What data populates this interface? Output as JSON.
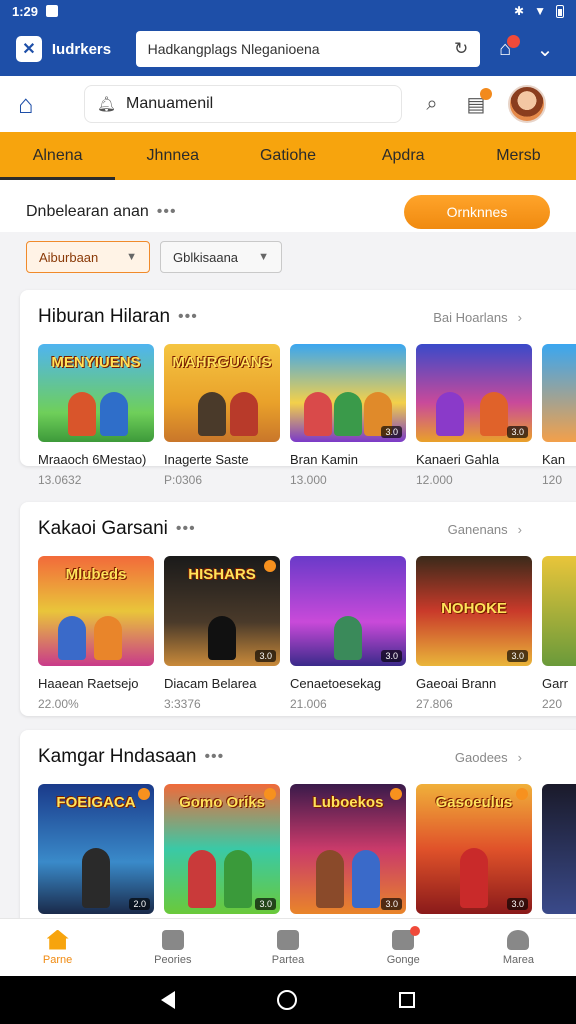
{
  "status_bar": {
    "time": "1:29"
  },
  "browser": {
    "app_name": "Iudrkers",
    "url": "Hadkangplags Nleganioena"
  },
  "header": {
    "search_text": "Manuamenil"
  },
  "category_tabs": [
    "Alnena",
    "Jhnnea",
    "Gatiohe",
    "Apdra",
    "Mersb"
  ],
  "sort": {
    "label": "Dnbelearan anan",
    "cta_label": "Ornknnes"
  },
  "filters": [
    {
      "label": "Aiburbaan"
    },
    {
      "label": "Gblkisaana"
    }
  ],
  "sections": [
    {
      "title": "Hiburan Hilaran",
      "more_label": "Bai Hoarlans",
      "cards": [
        {
          "art": "MENYIUENS",
          "name": "Mraaoch 6Mestao)",
          "meta": "13.0632"
        },
        {
          "art": "MAHRGUANS",
          "name": "Inagerte Saste",
          "meta": "P:0306"
        },
        {
          "art": "",
          "name": "Bran Kamin",
          "meta": "13.000"
        },
        {
          "art": "",
          "name": "Kanaeri Gahla",
          "meta": "12.000"
        },
        {
          "art": "",
          "name": "Kan",
          "meta": "120"
        }
      ]
    },
    {
      "title": "Kakaoi Garsani",
      "more_label": "Ganenans",
      "cards": [
        {
          "art": "Mlubeds",
          "name": "Haaean Raetsejo",
          "meta": "22.00%"
        },
        {
          "art": "HISHARS",
          "name": "Diacam Belarea",
          "meta": "3:3376"
        },
        {
          "art": "",
          "name": "Cenaetoesekag",
          "meta": "21.006"
        },
        {
          "art": "NOHOKE",
          "name": "Gaeoai Brann",
          "meta": "27.806"
        },
        {
          "art": "",
          "name": "Garr",
          "meta": "220"
        }
      ]
    },
    {
      "title": "Kamgar Hndasaan",
      "more_label": "Gaodees",
      "cards": [
        {
          "art": "FOEIGACA",
          "name": "",
          "meta": ""
        },
        {
          "art": "Gomo Oriks",
          "name": "",
          "meta": ""
        },
        {
          "art": "Luboekos",
          "name": "",
          "meta": ""
        },
        {
          "art": "Gasoeulus",
          "name": "",
          "meta": ""
        },
        {
          "art": "",
          "name": "",
          "meta": ""
        }
      ]
    }
  ],
  "bottom_nav": [
    {
      "label": "Parne",
      "icon": "home-icon"
    },
    {
      "label": "Peories",
      "icon": "gamepad-icon"
    },
    {
      "label": "Partea",
      "icon": "plane-icon"
    },
    {
      "label": "Gonge",
      "icon": "chat-icon"
    },
    {
      "label": "Marea",
      "icon": "profile-icon"
    }
  ],
  "colors": {
    "brand_blue": "#1e4fa8",
    "accent_orange": "#f7a40d",
    "cta_orange": "#f08a10"
  }
}
